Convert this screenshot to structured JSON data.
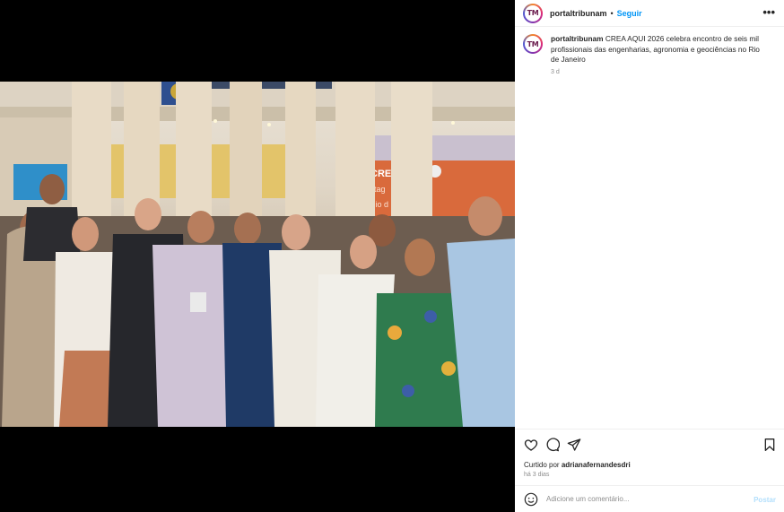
{
  "post": {
    "username": "portaltribunam",
    "follow_label": "Seguir",
    "separator": "•",
    "more_label": "•••",
    "avatar_text": "TM",
    "caption_username": "portaltribunam",
    "caption_text": "CREA AQUI 2026 celebra encontro de seis mil profissionais das engenharias, agronomia e geociências no Rio de Janeiro",
    "caption_time": "3 d",
    "liked_prefix": "Curtido por",
    "liked_user": "adrianafernandesdri",
    "posted_ago": "há 3 dias",
    "comment_placeholder": "Adicione um comentário...",
    "post_label": "Postar"
  },
  "icons": {
    "like": "heart-icon",
    "comment": "comment-icon",
    "share": "send-icon",
    "save": "bookmark-icon",
    "emoji": "emoji-icon"
  },
  "photo_text": {
    "banner_top": "CREA",
    "banner_line1": "otag",
    "banner_line2": "dese",
    "banner_line3": "Rio d"
  },
  "colors": {
    "follow": "#0095f6",
    "post_button": "#b2dffc",
    "muted": "#8e8e8e",
    "text": "#262626"
  }
}
